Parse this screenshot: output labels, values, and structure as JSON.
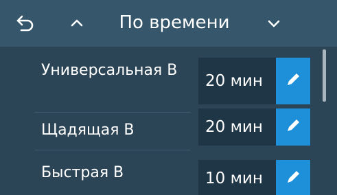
{
  "header": {
    "back_icon": "back-arrow-icon",
    "up_icon": "chevron-up-icon",
    "title": "По времени",
    "down_icon": "chevron-down-icon"
  },
  "programs": [
    {
      "label": "Универсальная В",
      "value": "20 мин",
      "edit_icon": "pencil-icon"
    },
    {
      "label": "Щадящая В",
      "value": "20 мин",
      "edit_icon": "pencil-icon"
    },
    {
      "label": "Быстрая В",
      "value": "10 мин",
      "edit_icon": "pencil-icon"
    }
  ],
  "colors": {
    "header_bg": "#36576b",
    "screen_bg": "#2c4556",
    "value_bg": "#1f3647",
    "accent": "#1e8fd9"
  }
}
